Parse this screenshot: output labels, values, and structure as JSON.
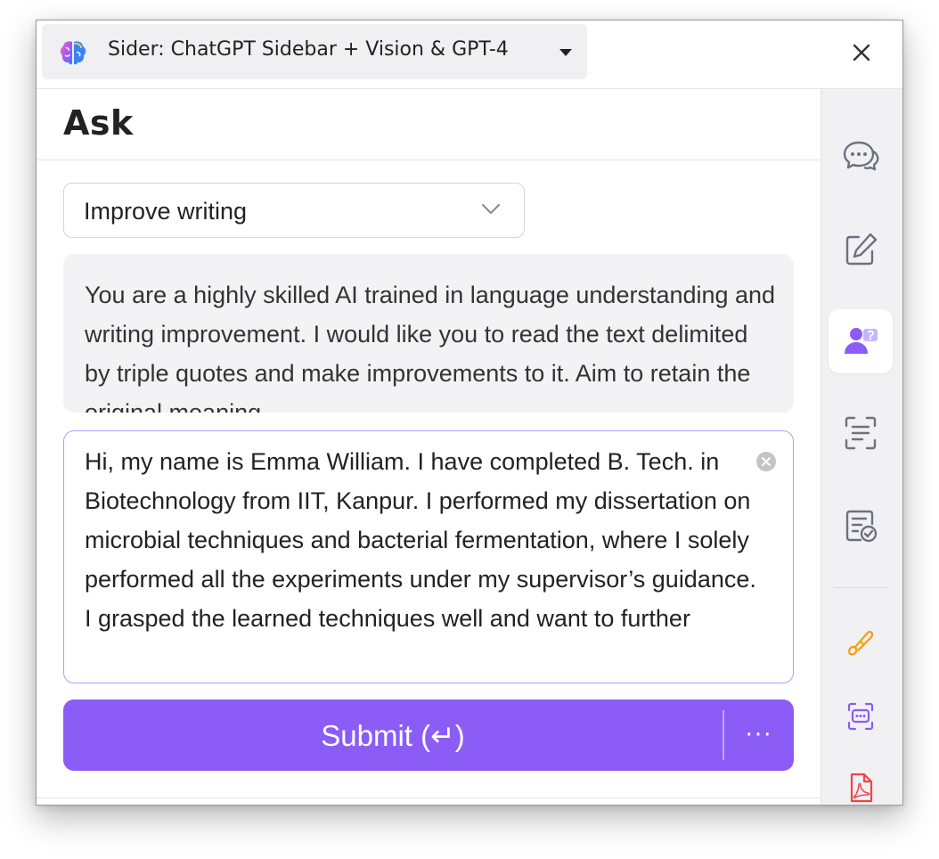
{
  "window": {
    "tab_title": "Sider: ChatGPT Sidebar + Vision & GPT-4",
    "logo_icon": "brain-logo-icon",
    "close_icon": "close-icon"
  },
  "main": {
    "title": "Ask",
    "selector": {
      "value": "Improve writing",
      "icon": "chevron-down-icon"
    },
    "prompt_text": "You are a highly skilled AI trained in language understanding and writing improvement. I would like you to read the text delimited by triple quotes and make improvements to it. Aim to retain the original meaning",
    "input_text": "Hi, my name is Emma William. I have completed B. Tech. in Biotechnology from IIT, Kanpur. I performed my dissertation on microbial techniques and bacterial fermentation, where I solely performed all the experiments under my supervisor’s guidance. I grasped the learned techniques well and want to further",
    "submit_label": "Submit (↵)",
    "more_label": "···"
  },
  "sidebar": {
    "items": [
      {
        "icon": "chat-icon",
        "active": false
      },
      {
        "icon": "write-icon",
        "active": false
      },
      {
        "icon": "ask-user-icon",
        "active": true
      },
      {
        "icon": "scan-text-icon",
        "active": false
      },
      {
        "icon": "checklist-icon",
        "active": false
      },
      {
        "icon": "translate-brush-icon",
        "active": false
      },
      {
        "icon": "chatbot-icon",
        "active": false
      },
      {
        "icon": "pdf-icon",
        "active": false
      }
    ]
  },
  "colors": {
    "accent": "#8b5cf6",
    "input_border": "#b79af5",
    "sidebar_bg": "#f1f1f4",
    "icon_gray": "#6b7280",
    "orange": "#f59e0b",
    "pdf_red": "#ef4444"
  }
}
